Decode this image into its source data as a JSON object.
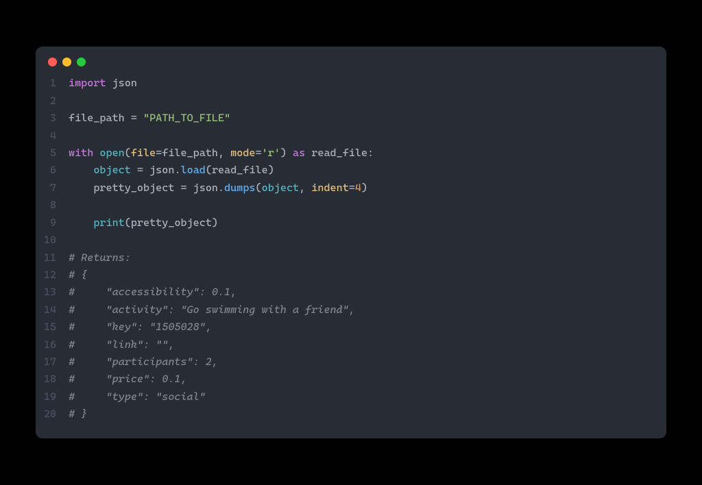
{
  "window": {
    "traffic_lights": [
      "close",
      "minimize",
      "zoom"
    ]
  },
  "code": {
    "language": "python",
    "lines": [
      {
        "n": 1,
        "tokens": [
          [
            "keyword",
            "import"
          ],
          [
            "plain",
            " "
          ],
          [
            "plain",
            "json"
          ]
        ]
      },
      {
        "n": 2,
        "tokens": []
      },
      {
        "n": 3,
        "tokens": [
          [
            "plain",
            "file_path "
          ],
          [
            "op",
            "="
          ],
          [
            "plain",
            " "
          ],
          [
            "string",
            "\"PATH_TO_FILE\""
          ]
        ]
      },
      {
        "n": 4,
        "tokens": []
      },
      {
        "n": 5,
        "tokens": [
          [
            "keyword",
            "with"
          ],
          [
            "plain",
            " "
          ],
          [
            "builtin",
            "open"
          ],
          [
            "paren",
            "("
          ],
          [
            "param",
            "file"
          ],
          [
            "op",
            "="
          ],
          [
            "plain",
            "file_path"
          ],
          [
            "plain",
            ", "
          ],
          [
            "param",
            "mode"
          ],
          [
            "op",
            "="
          ],
          [
            "string",
            "'r'"
          ],
          [
            "paren",
            ")"
          ],
          [
            "plain",
            " "
          ],
          [
            "keyword",
            "as"
          ],
          [
            "plain",
            " read_file:"
          ]
        ]
      },
      {
        "n": 6,
        "tokens": [
          [
            "plain",
            "    "
          ],
          [
            "builtin",
            "object"
          ],
          [
            "plain",
            " "
          ],
          [
            "op",
            "="
          ],
          [
            "plain",
            " json"
          ],
          [
            "dot",
            "."
          ],
          [
            "func",
            "load"
          ],
          [
            "paren",
            "("
          ],
          [
            "plain",
            "read_file"
          ],
          [
            "paren",
            ")"
          ]
        ]
      },
      {
        "n": 7,
        "tokens": [
          [
            "plain",
            "    pretty_object "
          ],
          [
            "op",
            "="
          ],
          [
            "plain",
            " json"
          ],
          [
            "dot",
            "."
          ],
          [
            "func",
            "dumps"
          ],
          [
            "paren",
            "("
          ],
          [
            "builtin",
            "object"
          ],
          [
            "plain",
            ", "
          ],
          [
            "param",
            "indent"
          ],
          [
            "op",
            "="
          ],
          [
            "number",
            "4"
          ],
          [
            "paren",
            ")"
          ]
        ]
      },
      {
        "n": 8,
        "tokens": []
      },
      {
        "n": 9,
        "tokens": [
          [
            "plain",
            "    "
          ],
          [
            "builtin",
            "print"
          ],
          [
            "paren",
            "("
          ],
          [
            "plain",
            "pretty_object"
          ],
          [
            "paren",
            ")"
          ]
        ]
      },
      {
        "n": 10,
        "tokens": []
      },
      {
        "n": 11,
        "tokens": [
          [
            "comment",
            "# Returns:"
          ]
        ]
      },
      {
        "n": 12,
        "tokens": [
          [
            "comment",
            "# {"
          ]
        ]
      },
      {
        "n": 13,
        "tokens": [
          [
            "comment",
            "#     \"accessibility\": 0.1,"
          ]
        ]
      },
      {
        "n": 14,
        "tokens": [
          [
            "comment",
            "#     \"activity\": \"Go swimming with a friend\","
          ]
        ]
      },
      {
        "n": 15,
        "tokens": [
          [
            "comment",
            "#     \"key\": \"1505028\","
          ]
        ]
      },
      {
        "n": 16,
        "tokens": [
          [
            "comment",
            "#     \"link\": \"\","
          ]
        ]
      },
      {
        "n": 17,
        "tokens": [
          [
            "comment",
            "#     \"participants\": 2,"
          ]
        ]
      },
      {
        "n": 18,
        "tokens": [
          [
            "comment",
            "#     \"price\": 0.1,"
          ]
        ]
      },
      {
        "n": 19,
        "tokens": [
          [
            "comment",
            "#     \"type\": \"social\""
          ]
        ]
      },
      {
        "n": 20,
        "tokens": [
          [
            "comment",
            "# }"
          ]
        ]
      }
    ]
  }
}
